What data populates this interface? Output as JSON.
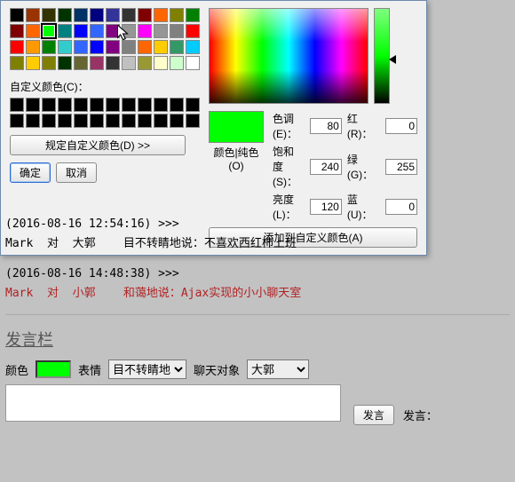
{
  "dialog": {
    "custom_label": "自定义颜色(C)：",
    "spec_button": "规定自定义颜色(D) >>",
    "ok": "确定",
    "cancel": "取消",
    "preview_label": "颜色|纯色(O)",
    "add_custom": "添加到自定义颜色(A)",
    "params": {
      "hue_label": "色调(E)：",
      "hue": "80",
      "sat_label": "饱和度(S)：",
      "sat": "240",
      "lum_label": "亮度(L)：",
      "lum": "120",
      "red_label": "红(R)：",
      "red": "0",
      "green_label": "绿(G)：",
      "green": "255",
      "blue_label": "蓝(U)：",
      "blue": "0"
    },
    "preview_color": "#00ff00",
    "basic_colors": [
      [
        "#000000",
        "#993300",
        "#333300",
        "#003300",
        "#003366",
        "#000080",
        "#333399",
        "#333333",
        "#800000",
        "#ff6600",
        "#808000",
        "#008000"
      ],
      [
        "#800000",
        "#ff6600",
        "#00ff00",
        "#008080",
        "#0000ff",
        "#3366ff",
        "#800080",
        "#969696",
        "#ff00ff",
        "#969696",
        "#808080",
        "#ff0000"
      ],
      [
        "#ff0000",
        "#ff9900",
        "#008000",
        "#33cccc",
        "#3366ff",
        "#0000ff",
        "#800080",
        "#808080",
        "#ff6600",
        "#ffcc00",
        "#339966",
        "#00ccff"
      ],
      [
        "#808000",
        "#ffcc00",
        "#808000",
        "#003300",
        "#666633",
        "#993366",
        "#333333",
        "#c0c0c0",
        "#999933",
        "#ffffcc",
        "#ccffcc",
        "#ffffff"
      ]
    ]
  },
  "messages": [
    {
      "ts": "(2016-08-16 12:54:16) >>>",
      "sender": "Mark  对  大郭",
      "body": "目不转睛地说：不喜欢西红柿上班",
      "color": "black"
    },
    {
      "ts": "(2016-08-16 14:48:38) >>>",
      "sender": "Mark  对  小郭",
      "body": "和蔼地说：Ajax实现的小小聊天室",
      "color": "red"
    }
  ],
  "panel": {
    "title": "发言栏",
    "color_label": "颜色",
    "expr_label": "表情",
    "target_label": "聊天对象",
    "expr_options": [
      "目不转睛地"
    ],
    "expr_value": "目不转睛地",
    "target_options": [
      "大郭"
    ],
    "target_value": "大郭",
    "send_button": "发言",
    "send_label": "发言：",
    "swatch_color": "#00ff00"
  }
}
